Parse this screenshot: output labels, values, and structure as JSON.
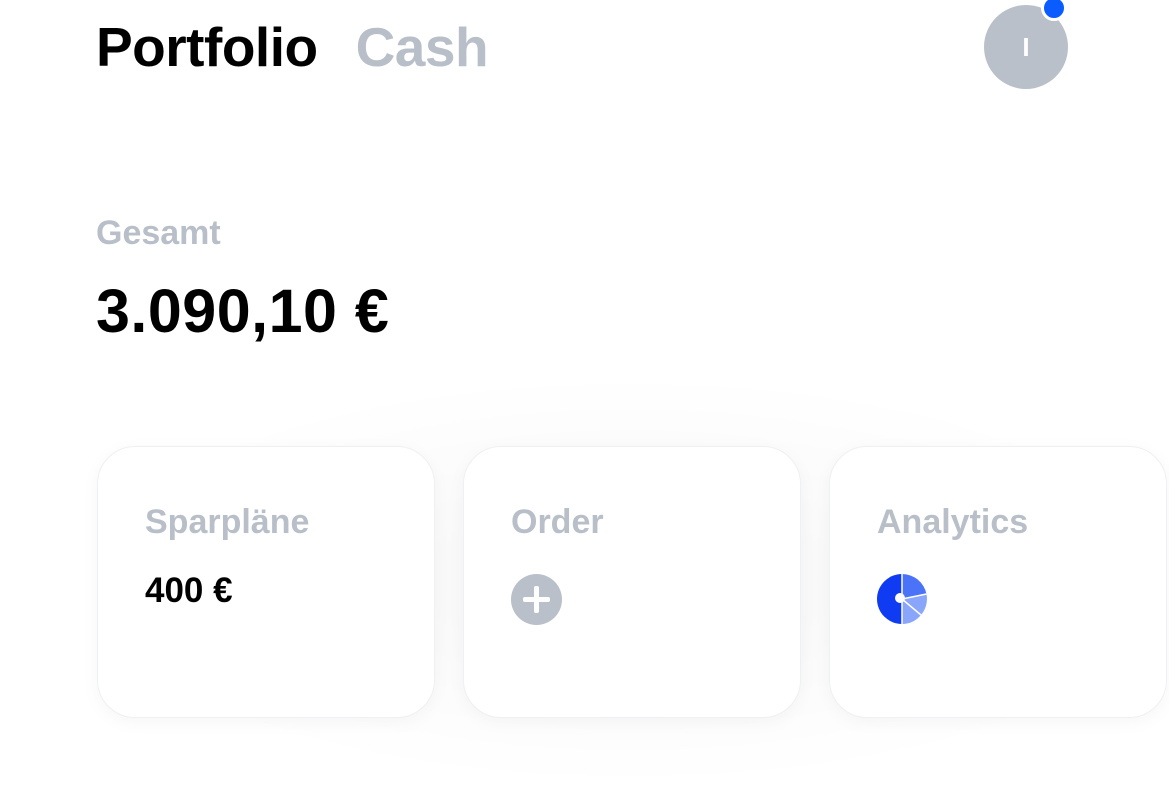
{
  "header": {
    "tabs": [
      {
        "label": "Portfolio",
        "active": true
      },
      {
        "label": "Cash",
        "active": false
      }
    ],
    "avatar_initial": "I",
    "notification": true
  },
  "summary": {
    "label": "Gesamt",
    "value": "3.090,10 €"
  },
  "cards": [
    {
      "title": "Sparpläne",
      "value": "400 €"
    },
    {
      "title": "Order",
      "icon": "plus-icon"
    },
    {
      "title": "Analytics",
      "icon": "pie-chart-icon"
    }
  ],
  "colors": {
    "accent": "#0a5cff",
    "muted": "#b8bfc9",
    "text": "#000000",
    "pie_dark": "#0f3cf2",
    "pie_mid": "#4a73f7",
    "pie_light": "#8aa6fb"
  }
}
